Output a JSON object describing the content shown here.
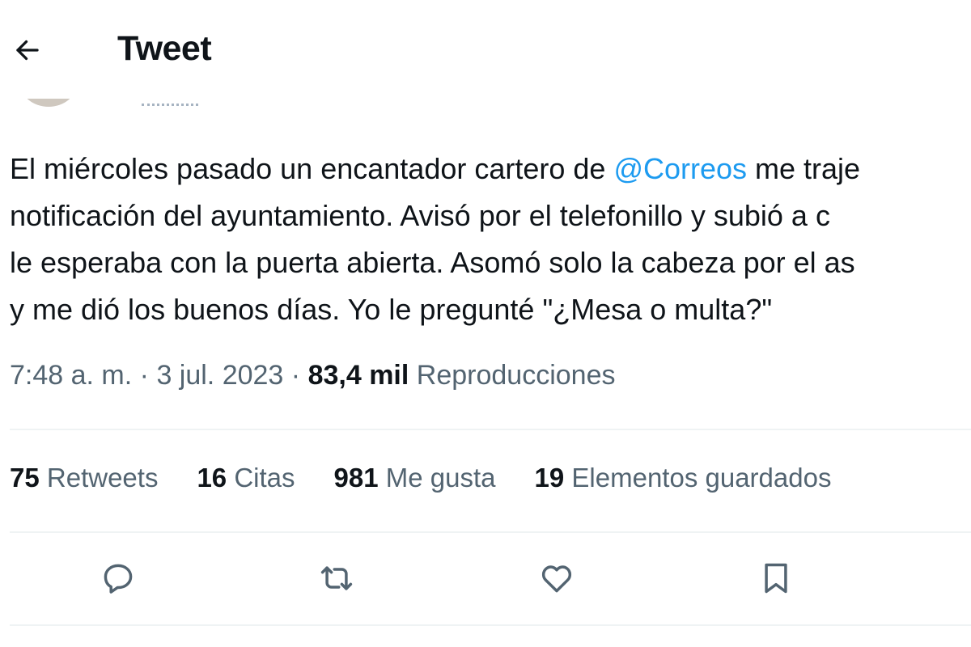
{
  "header": {
    "title": "Tweet",
    "back_icon": "arrow-left-icon"
  },
  "tweet": {
    "lines": [
      {
        "before": "El miércoles pasado un encantador cartero de ",
        "mention": "@Correos",
        "after": " me traje"
      },
      {
        "text": "notificación del ayuntamiento. Avisó por el telefonillo y subió a c"
      },
      {
        "text": "le esperaba con la puerta abierta. Asomó solo la cabeza por el as"
      },
      {
        "text": "y me dió los buenos días. Yo le pregunté \"¿Mesa o multa?\""
      }
    ],
    "time": "7:48 a. m.",
    "date": "3 jul. 2023",
    "separator": "·",
    "views_count": "83,4 mil",
    "views_label": "Reproducciones"
  },
  "stats": [
    {
      "count": "75",
      "label": "Retweets"
    },
    {
      "count": "16",
      "label": "Citas"
    },
    {
      "count": "981",
      "label": "Me gusta"
    },
    {
      "count": "19",
      "label": "Elementos guardados"
    }
  ],
  "actions": [
    {
      "name": "reply",
      "icon": "reply-icon"
    },
    {
      "name": "retweet",
      "icon": "retweet-icon"
    },
    {
      "name": "like",
      "icon": "heart-icon"
    },
    {
      "name": "bookmark",
      "icon": "bookmark-icon"
    }
  ],
  "colors": {
    "accent": "#1d9bf0",
    "text_primary": "#0f1419",
    "text_secondary": "#536471",
    "divider": "#eff3f4"
  }
}
